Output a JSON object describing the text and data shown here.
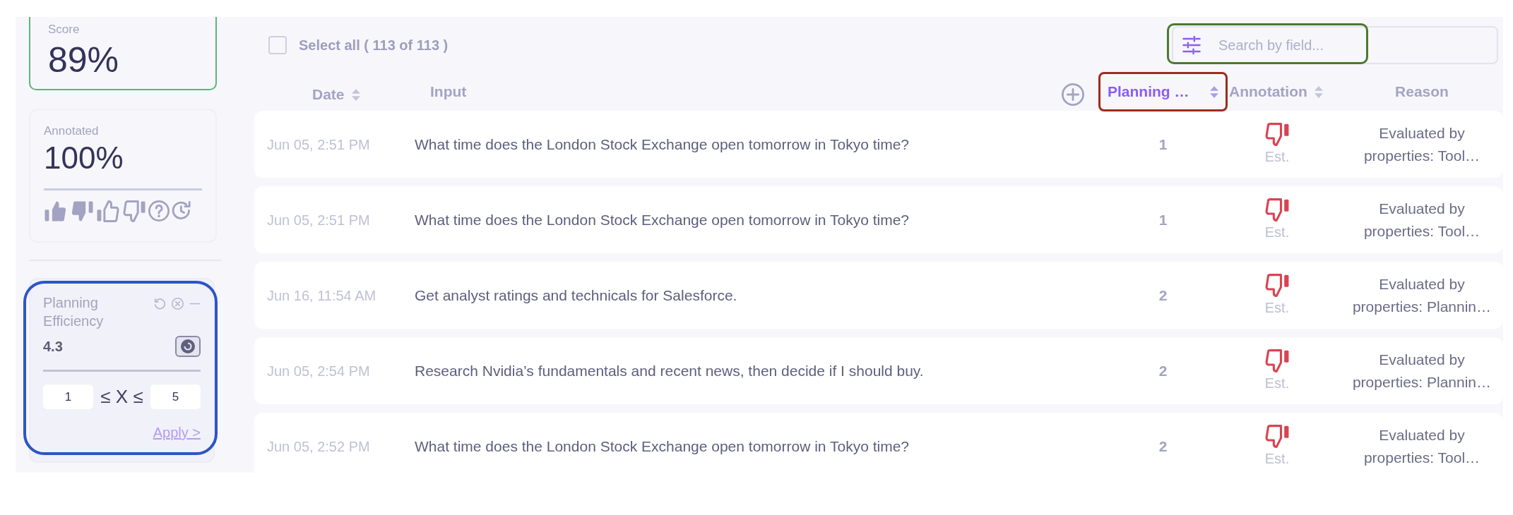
{
  "sidebar": {
    "score_card": {
      "label": "Score",
      "value": "89%"
    },
    "annotated_card": {
      "label": "Annotated",
      "value": "100%"
    },
    "filter_card": {
      "title": "Planning Efficiency",
      "value": "4.3",
      "range_min": "1",
      "range_operator": "≤ X ≤",
      "range_max": "5",
      "apply": "Apply >",
      "highlighted": true
    }
  },
  "toolbar": {
    "select_all": {
      "label": "Select all ( 113 of 113 )",
      "checked": false
    },
    "search": {
      "placeholder": "Search by field...",
      "highlighted": true
    }
  },
  "table": {
    "columns": [
      {
        "label": "Date",
        "sortable": true,
        "active": false,
        "highlighted": false
      },
      {
        "label": "Input",
        "sortable": false,
        "active": false,
        "highlighted": false
      },
      {
        "label": "Planning …",
        "sortable": true,
        "active": true,
        "highlighted": true
      },
      {
        "label": "Annotation",
        "sortable": true,
        "active": false,
        "highlighted": false
      },
      {
        "label": "Reason",
        "sortable": false,
        "active": false,
        "highlighted": false
      }
    ],
    "rows": [
      {
        "date": "Jun 05, 2:51 PM",
        "input": "What time does the London Stock Exchange open tomorrow in Tokyo time?",
        "planning": "1",
        "annotation": "Est.",
        "reason": "Evaluated by properties: Tool…"
      },
      {
        "date": "Jun 05, 2:51 PM",
        "input": "What time does the London Stock Exchange open tomorrow in Tokyo time?",
        "planning": "1",
        "annotation": "Est.",
        "reason": "Evaluated by properties: Tool…"
      },
      {
        "date": "Jun 16, 11:54 AM",
        "input": "Get analyst ratings and technicals for Salesforce.",
        "planning": "2",
        "annotation": "Est.",
        "reason": "Evaluated by properties: Plannin…"
      },
      {
        "date": "Jun 05, 2:54 PM",
        "input": "Research Nvidia’s fundamentals and recent news, then decide if I should buy.",
        "planning": "2",
        "annotation": "Est.",
        "reason": "Evaluated by properties: Plannin…"
      },
      {
        "date": "Jun 05, 2:52 PM",
        "input": "What time does the London Stock Exchange open tomorrow in Tokyo time?",
        "planning": "2",
        "annotation": "Est.",
        "reason": "Evaluated by properties: Tool…"
      }
    ]
  }
}
